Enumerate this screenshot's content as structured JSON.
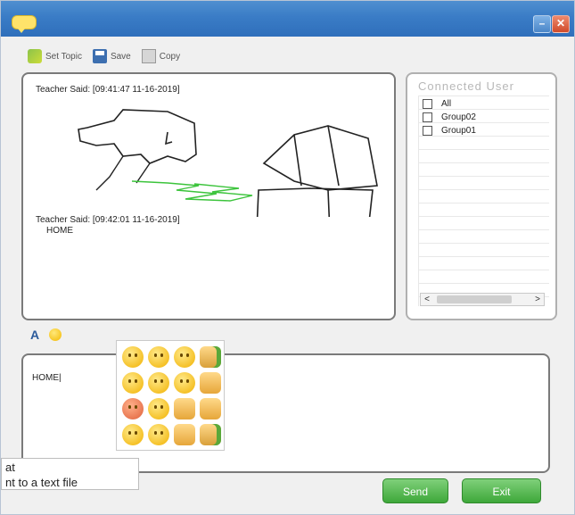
{
  "window": {
    "title": "",
    "minimize_label": "–",
    "close_label": "✕"
  },
  "toolbar": {
    "set_topic_label": "Set Topic",
    "save_label": "Save",
    "copy_label": "Copy"
  },
  "chat": {
    "messages": [
      {
        "header": "Teacher Said: [09:41:47 11-16-2019]",
        "text": ""
      },
      {
        "header": "Teacher Said: [09:42:01 11-16-2019]",
        "text": "HOME"
      }
    ]
  },
  "connected_users": {
    "header": "Connected User",
    "items": [
      {
        "label": "All",
        "checked": false
      },
      {
        "label": "Group02",
        "checked": false
      },
      {
        "label": "Group01",
        "checked": false
      }
    ],
    "scroll_left": "<",
    "scroll_right": ">"
  },
  "input": {
    "format_label": "A",
    "value": "HOME|"
  },
  "emoji_picker": {
    "icons": [
      "smile",
      "grin",
      "laugh",
      "thumbs-up",
      "cool",
      "kiss",
      "wink",
      "hand",
      "angry",
      "shocked",
      "peace-hand",
      "victory-hand",
      "sunglasses",
      "sad",
      "fist",
      "thumbs-down"
    ]
  },
  "tooltip": {
    "line1": "at",
    "line2": "nt to a text file"
  },
  "actions": {
    "send_label": "Send",
    "exit_label": "Exit"
  },
  "colors": {
    "titlebar": "#3a7cc6",
    "button_green": "#3ea83a",
    "close_red": "#d04a2a"
  }
}
